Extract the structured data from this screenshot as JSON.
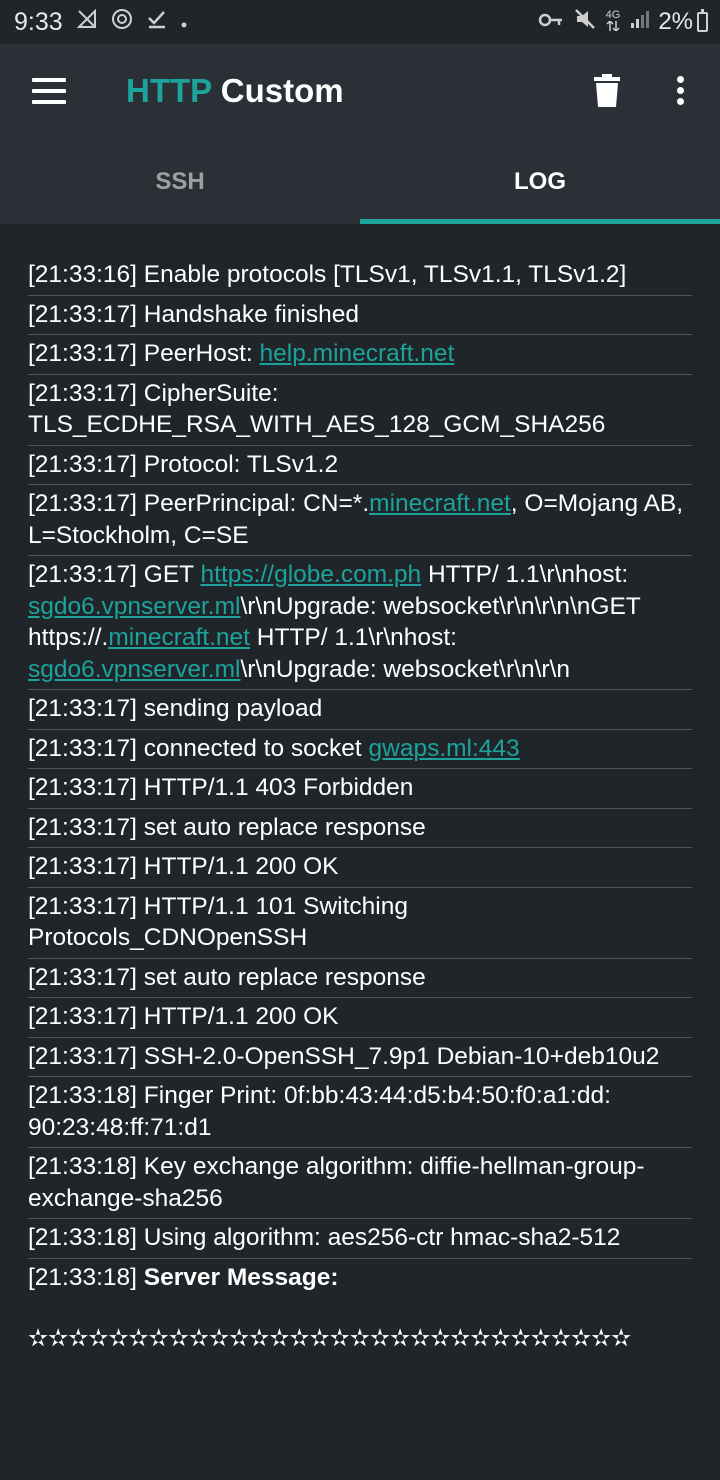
{
  "status_bar": {
    "time": "9:33",
    "left_icons": [
      "signal-off-icon",
      "sync-icon",
      "check-download-icon",
      "dot-icon"
    ],
    "right_icons": [
      "vpn-key-icon",
      "mute-icon",
      "4g-icon",
      "signal-icon"
    ],
    "battery_text": "2%",
    "network_label": "4G"
  },
  "app_bar": {
    "title_accent": "HTTP",
    "title_rest": "Custom",
    "colors": {
      "accent": "#1ba39c",
      "background": "#2a3035"
    }
  },
  "tabs": [
    {
      "label": "SSH",
      "active": false
    },
    {
      "label": "LOG",
      "active": true
    }
  ],
  "log": {
    "e1": "[21:33:16] Enable protocols [TLSv1, TLSv1.1, TLSv1.2]",
    "e2": "[21:33:17] Handshake finished",
    "e3_prefix": "[21:33:17] PeerHost: ",
    "e3_link": "help.minecraft.net",
    "e4": "[21:33:17] CipherSuite: TLS_ECDHE_RSA_WITH_AES_128_GCM_SHA256",
    "e5": "[21:33:17] Protocol: TLSv1.2",
    "e6_a": "[21:33:17] PeerPrincipal: CN=*.",
    "e6_link": "minecraft.net",
    "e6_b": ", O=Mojang AB, L=Stockholm, C=SE",
    "e7_a": "[21:33:17] GET ",
    "e7_link1": "https://globe.com.ph",
    "e7_b": " HTTP/ 1.1\\r\\nhost: ",
    "e7_link2": "sgdo6.vpnserver.ml",
    "e7_c": "\\r\\nUpgrade: websocket\\r\\n\\r\\n\\nGET https://.",
    "e7_link3": "minecraft.net",
    "e7_d": " HTTP/ 1.1\\r\\nhost: ",
    "e7_link4": "sgdo6.vpnserver.ml",
    "e7_e": "\\r\\nUpgrade: websocket\\r\\n\\r\\n",
    "e8": "[21:33:17] sending payload",
    "e9_prefix": "[21:33:17] connected to socket ",
    "e9_link": "gwaps.ml:443",
    "e10": "[21:33:17] HTTP/1.1 403 Forbidden",
    "e11": "[21:33:17] set auto replace response",
    "e12": "[21:33:17] HTTP/1.1 200 OK",
    "e13": "[21:33:17] HTTP/1.1 101 Switching Protocols_CDNOpenSSH",
    "e14": "[21:33:17] set auto replace response",
    "e15": "[21:33:17] HTTP/1.1 200 OK",
    "e16": "[21:33:17] SSH-2.0-OpenSSH_7.9p1 Debian-10+deb10u2",
    "e17": "[21:33:18] Finger Print: 0f:bb:43:44:d5:b4:50:f0:a1:dd: 90:23:48:ff:71:d1",
    "e18": "[21:33:18] Key exchange algorithm: diffie-hellman-group-exchange-sha256",
    "e19": "[21:33:18] Using algorithm: aes256-ctr hmac-sha2-512",
    "e20_prefix": "[21:33:18] ",
    "e20_bold": "Server Message:",
    "stars": "✫✫✫✫✫✫✫✫✫✫✫✫✫✫✫✫✫✫✫✫✫✫✫✫✫✫✫✫✫✫"
  }
}
